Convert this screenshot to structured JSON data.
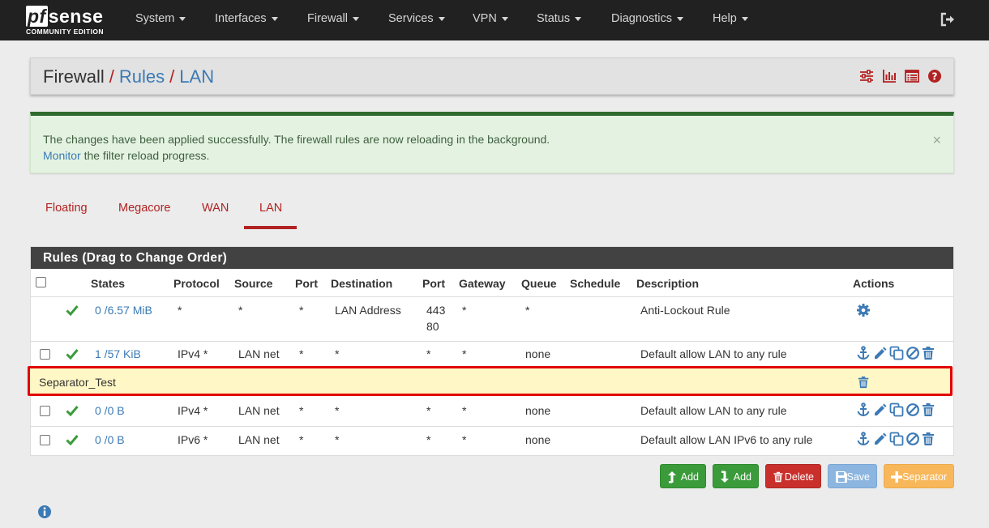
{
  "navbar": {
    "logo_pf": "pf",
    "logo_sense": "sense",
    "logo_sub": "COMMUNITY EDITION",
    "items": [
      {
        "label": "System"
      },
      {
        "label": "Interfaces"
      },
      {
        "label": "Firewall"
      },
      {
        "label": "Services"
      },
      {
        "label": "VPN"
      },
      {
        "label": "Status"
      },
      {
        "label": "Diagnostics"
      },
      {
        "label": "Help"
      }
    ],
    "logout_icon": "sign-out-icon"
  },
  "breadcrumb": {
    "items": [
      "Firewall",
      "Rules",
      "LAN"
    ],
    "separator": "/",
    "icons": [
      "sliders-icon",
      "bar-chart-icon",
      "list-alt-icon",
      "question-circle-icon"
    ]
  },
  "alert": {
    "line1": "The changes have been applied successfully. The firewall rules are now reloading in the background.",
    "link_text": "Monitor",
    "line2_rest": " the filter reload progress.",
    "close": "×"
  },
  "tabs": [
    {
      "label": "Floating"
    },
    {
      "label": "Megacore"
    },
    {
      "label": "WAN"
    },
    {
      "label": "LAN",
      "active": true
    }
  ],
  "rules": {
    "title": "Rules (Drag to Change Order)",
    "columns": [
      "States",
      "Protocol",
      "Source",
      "Port",
      "Destination",
      "Port",
      "Gateway",
      "Queue",
      "Schedule",
      "Description",
      "Actions"
    ],
    "rows": [
      {
        "states": "0 /6.57 MiB",
        "protocol": "*",
        "source": "*",
        "sport": "*",
        "destination": "LAN Address",
        "dport_1": "443",
        "dport_2": "80",
        "gateway": "*",
        "queue": "*",
        "schedule": "",
        "description": "Anti-Lockout Rule"
      },
      {
        "states": "1 /57 KiB",
        "protocol": "IPv4 *",
        "source": "LAN net",
        "sport": "*",
        "destination": "*",
        "dport": "*",
        "gateway": "*",
        "queue": "none",
        "schedule": "",
        "description": "Default allow LAN to any rule"
      },
      {
        "states": "0 /0 B",
        "protocol": "IPv4 *",
        "source": "LAN net",
        "sport": "*",
        "destination": "*",
        "dport": "*",
        "gateway": "*",
        "queue": "none",
        "schedule": "",
        "description": "Default allow LAN to any rule"
      },
      {
        "states": "0 /0 B",
        "protocol": "IPv6 *",
        "source": "LAN net",
        "sport": "*",
        "destination": "*",
        "dport": "*",
        "gateway": "*",
        "queue": "none",
        "schedule": "",
        "description": "Default allow LAN IPv6 to any rule"
      }
    ],
    "separator_label": "Separator_Test"
  },
  "buttons": {
    "add_top": "Add",
    "add_bottom": "Add",
    "delete": "Delete",
    "save": "Save",
    "separator": "Separator"
  },
  "colors": {
    "navbar": "#212121",
    "accent_red": "#b22222",
    "link_blue": "#3c7ab5",
    "success_green": "#3b9b3b",
    "danger_red": "#c9302c",
    "separator_bg": "#fff8c6",
    "highlight_border": "#e00000"
  }
}
